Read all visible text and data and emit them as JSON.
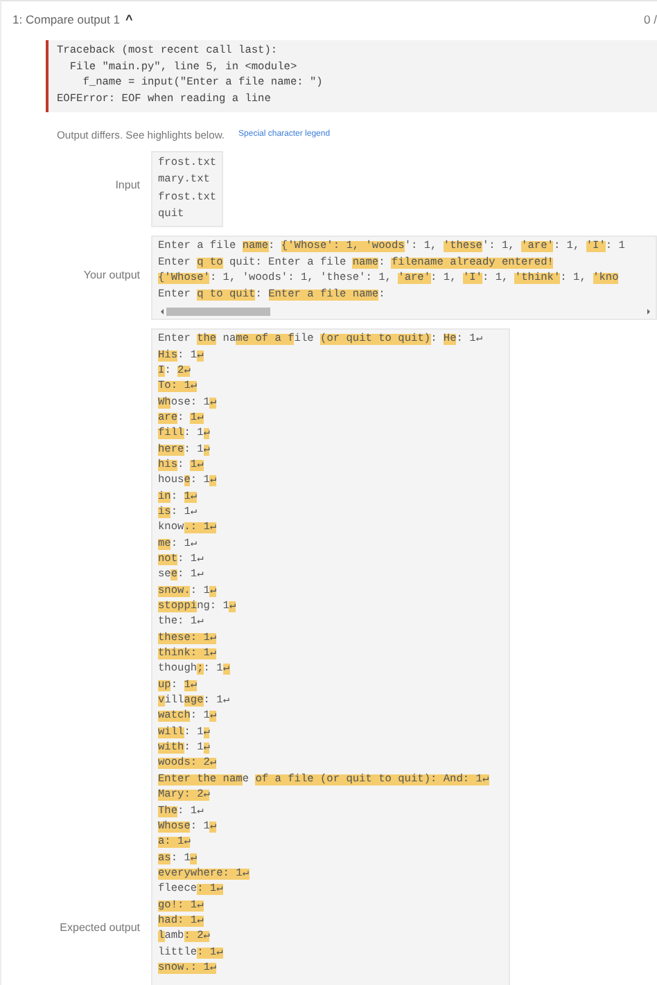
{
  "header": {
    "title": "1: Compare output 1",
    "collapse_icon": "^",
    "score": "0 /"
  },
  "error": {
    "lines": [
      "Traceback (most recent call last):",
      "  File \"main.py\", line 5, in <module>",
      "    f_name = input(\"Enter a file name: \")",
      "EOFError: EOF when reading a line"
    ]
  },
  "status": {
    "message": "Output differs. See highlights below.",
    "legend_link": "Special character legend"
  },
  "input": {
    "label": "Input",
    "lines": [
      "frost.txt",
      "mary.txt",
      "frost.txt",
      "quit"
    ]
  },
  "your_output": {
    "label": "Your output",
    "lines": [
      [
        {
          "text": "Enter a file ",
          "highlighted": false
        },
        {
          "text": "name",
          "highlighted": true
        },
        {
          "text": ": ",
          "highlighted": false
        },
        {
          "text": "{'Whose': 1, 'woods",
          "highlighted": true
        },
        {
          "text": "': 1, ",
          "highlighted": false
        },
        {
          "text": "'these",
          "highlighted": true
        },
        {
          "text": "': 1, ",
          "highlighted": false
        },
        {
          "text": "'are'",
          "highlighted": true
        },
        {
          "text": ": 1, ",
          "highlighted": false
        },
        {
          "text": "'I'",
          "highlighted": true
        },
        {
          "text": ": 1",
          "highlighted": false
        }
      ],
      [
        {
          "text": "Enter ",
          "highlighted": false
        },
        {
          "text": "q to",
          "highlighted": true
        },
        {
          "text": " quit: Enter a file ",
          "highlighted": false
        },
        {
          "text": "name",
          "highlighted": true
        },
        {
          "text": ": ",
          "highlighted": false
        },
        {
          "text": "filename already entered!",
          "highlighted": true
        }
      ],
      [
        {
          "text": "{'Whose'",
          "highlighted": true
        },
        {
          "text": ": 1, 'woods': 1, 'these': 1, ",
          "highlighted": false
        },
        {
          "text": "'are'",
          "highlighted": true
        },
        {
          "text": ": 1, ",
          "highlighted": false
        },
        {
          "text": "'I'",
          "highlighted": true
        },
        {
          "text": ": 1, ",
          "highlighted": false
        },
        {
          "text": "'think'",
          "highlighted": true
        },
        {
          "text": ": 1, ",
          "highlighted": false
        },
        {
          "text": "'kno",
          "highlighted": true
        }
      ],
      [
        {
          "text": "Enter ",
          "highlighted": false
        },
        {
          "text": "q to quit",
          "highlighted": true
        },
        {
          "text": ": ",
          "highlighted": false
        },
        {
          "text": "Enter a file name",
          "highlighted": true
        },
        {
          "text": ":",
          "highlighted": false
        }
      ]
    ]
  },
  "expected_output": {
    "label": "Expected output",
    "lines": [
      [
        {
          "text": "Enter ",
          "highlighted": false
        },
        {
          "text": "the",
          "highlighted": true
        },
        {
          "text": " na",
          "highlighted": false
        },
        {
          "text": "me of a f",
          "highlighted": true
        },
        {
          "text": "ile ",
          "highlighted": false
        },
        {
          "text": "(or quit to quit)",
          "highlighted": true
        },
        {
          "text": ": ",
          "highlighted": false
        },
        {
          "text": "He",
          "highlighted": true
        },
        {
          "text": ": 1↵",
          "highlighted": false
        }
      ],
      [
        {
          "text": "His",
          "highlighted": true
        },
        {
          "text": ": 1",
          "highlighted": false
        },
        {
          "text": "↵",
          "highlighted": true
        }
      ],
      [
        {
          "text": "I",
          "highlighted": true
        },
        {
          "text": ": ",
          "highlighted": false
        },
        {
          "text": "2↵",
          "highlighted": true
        }
      ],
      [
        {
          "text": "To: 1↵",
          "highlighted": true
        }
      ],
      [
        {
          "text": "Wh",
          "highlighted": true
        },
        {
          "text": "ose: 1",
          "highlighted": false
        },
        {
          "text": "↵",
          "highlighted": true
        }
      ],
      [
        {
          "text": "are",
          "highlighted": true
        },
        {
          "text": ": ",
          "highlighted": false
        },
        {
          "text": "1↵",
          "highlighted": true
        }
      ],
      [
        {
          "text": "fill",
          "highlighted": true
        },
        {
          "text": ": 1",
          "highlighted": false
        },
        {
          "text": "↵",
          "highlighted": true
        }
      ],
      [
        {
          "text": "here",
          "highlighted": true
        },
        {
          "text": ": 1",
          "highlighted": false
        },
        {
          "text": "↵",
          "highlighted": true
        }
      ],
      [
        {
          "text": "his",
          "highlighted": true
        },
        {
          "text": ": ",
          "highlighted": false
        },
        {
          "text": "1↵",
          "highlighted": true
        }
      ],
      [
        {
          "text": "hous",
          "highlighted": false
        },
        {
          "text": "e",
          "highlighted": true
        },
        {
          "text": ": 1",
          "highlighted": false
        },
        {
          "text": "↵",
          "highlighted": true
        }
      ],
      [
        {
          "text": "in",
          "highlighted": true
        },
        {
          "text": ": ",
          "highlighted": false
        },
        {
          "text": "1↵",
          "highlighted": true
        }
      ],
      [
        {
          "text": "is",
          "highlighted": true
        },
        {
          "text": ": 1↵",
          "highlighted": false
        }
      ],
      [
        {
          "text": "know",
          "highlighted": false
        },
        {
          "text": ".: 1↵",
          "highlighted": true
        }
      ],
      [
        {
          "text": "me",
          "highlighted": true
        },
        {
          "text": ": 1↵",
          "highlighted": false
        }
      ],
      [
        {
          "text": "not",
          "highlighted": true
        },
        {
          "text": ": 1↵",
          "highlighted": false
        }
      ],
      [
        {
          "text": "se",
          "highlighted": false
        },
        {
          "text": "e",
          "highlighted": true
        },
        {
          "text": ": 1↵",
          "highlighted": false
        }
      ],
      [
        {
          "text": "snow.",
          "highlighted": true
        },
        {
          "text": ": 1",
          "highlighted": false
        },
        {
          "text": "↵",
          "highlighted": true
        }
      ],
      [
        {
          "text": "stoppi",
          "highlighted": true
        },
        {
          "text": "ng: 1",
          "highlighted": false
        },
        {
          "text": "↵",
          "highlighted": true
        }
      ],
      [
        {
          "text": "the: 1↵",
          "highlighted": false
        }
      ],
      [
        {
          "text": "these: 1↵",
          "highlighted": true
        }
      ],
      [
        {
          "text": "think: 1↵",
          "highlighted": true
        }
      ],
      [
        {
          "text": "though",
          "highlighted": false
        },
        {
          "text": ";",
          "highlighted": true
        },
        {
          "text": ": 1",
          "highlighted": false
        },
        {
          "text": "↵",
          "highlighted": true
        }
      ],
      [
        {
          "text": "up",
          "highlighted": true
        },
        {
          "text": ": ",
          "highlighted": false
        },
        {
          "text": "1↵",
          "highlighted": true
        }
      ],
      [
        {
          "text": "v",
          "highlighted": true
        },
        {
          "text": "ill",
          "highlighted": false
        },
        {
          "text": "age",
          "highlighted": true
        },
        {
          "text": ": 1↵",
          "highlighted": false
        }
      ],
      [
        {
          "text": "watch",
          "highlighted": true
        },
        {
          "text": ": 1",
          "highlighted": false
        },
        {
          "text": "↵",
          "highlighted": true
        }
      ],
      [
        {
          "text": "will",
          "highlighted": true
        },
        {
          "text": ": 1",
          "highlighted": false
        },
        {
          "text": "↵",
          "highlighted": true
        }
      ],
      [
        {
          "text": "with",
          "highlighted": true
        },
        {
          "text": ": 1",
          "highlighted": false
        },
        {
          "text": "↵",
          "highlighted": true
        }
      ],
      [
        {
          "text": "woods: 2↵",
          "highlighted": true
        }
      ],
      [
        {
          "text": "Enter the nam",
          "highlighted": true
        },
        {
          "text": "e ",
          "highlighted": false
        },
        {
          "text": "of a file (or quit to quit): And: 1↵",
          "highlighted": true
        }
      ],
      [
        {
          "text": "Mary: 2↵",
          "highlighted": true
        }
      ],
      [
        {
          "text": "The",
          "highlighted": true
        },
        {
          "text": ": 1↵",
          "highlighted": false
        }
      ],
      [
        {
          "text": "Whose",
          "highlighted": true
        },
        {
          "text": ": 1",
          "highlighted": false
        },
        {
          "text": "↵",
          "highlighted": true
        }
      ],
      [
        {
          "text": "a: 1↵",
          "highlighted": true
        }
      ],
      [
        {
          "text": "as",
          "highlighted": true
        },
        {
          "text": ": 1",
          "highlighted": false
        },
        {
          "text": "↵",
          "highlighted": true
        }
      ],
      [
        {
          "text": "everywhere: 1↵",
          "highlighted": true
        }
      ],
      [
        {
          "text": "fleece",
          "highlighted": false
        },
        {
          "text": ": 1↵",
          "highlighted": true
        }
      ],
      [
        {
          "text": "go!: 1↵",
          "highlighted": true
        }
      ],
      [
        {
          "text": "had: 1↵",
          "highlighted": true
        }
      ],
      [
        {
          "text": "l",
          "highlighted": true
        },
        {
          "text": "amb",
          "highlighted": false
        },
        {
          "text": ": 2↵",
          "highlighted": true
        }
      ],
      [
        {
          "text": "little",
          "highlighted": false
        },
        {
          "text": ": 1↵",
          "highlighted": true
        }
      ],
      [
        {
          "text": "snow.: 1↵",
          "highlighted": true
        }
      ]
    ]
  }
}
